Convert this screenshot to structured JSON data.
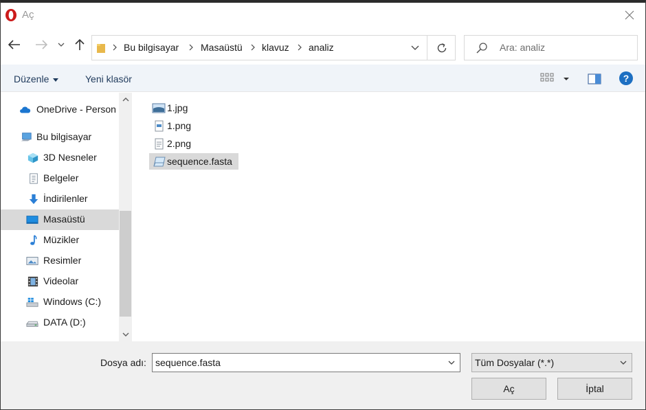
{
  "window": {
    "title": "Aç"
  },
  "navigation": {
    "breadcrumb": [
      "Bu bilgisayar",
      "Masaüstü",
      "klavuz",
      "analiz"
    ],
    "search_placeholder": "Ara: analiz"
  },
  "toolbar": {
    "organize_label": "Düzenle",
    "new_folder_label": "Yeni klasör"
  },
  "sidebar": {
    "items": [
      {
        "label": "OneDrive - Person",
        "icon": "cloud-icon"
      },
      {
        "label": "Bu bilgisayar",
        "icon": "computer-icon"
      },
      {
        "label": "3D Nesneler",
        "icon": "cube-icon"
      },
      {
        "label": "Belgeler",
        "icon": "document-icon"
      },
      {
        "label": "İndirilenler",
        "icon": "download-arrow-icon"
      },
      {
        "label": "Masaüstü",
        "icon": "desktop-icon",
        "selected": true
      },
      {
        "label": "Müzikler",
        "icon": "music-note-icon"
      },
      {
        "label": "Resimler",
        "icon": "picture-icon"
      },
      {
        "label": "Videolar",
        "icon": "film-icon"
      },
      {
        "label": "Windows (C:)",
        "icon": "windows-drive-icon"
      },
      {
        "label": "DATA (D:)",
        "icon": "drive-icon"
      }
    ]
  },
  "files": [
    {
      "name": "1.jpg",
      "icon": "image-file-icon"
    },
    {
      "name": "1.png",
      "icon": "png-file-icon"
    },
    {
      "name": "2.png",
      "icon": "png-file-icon"
    },
    {
      "name": "sequence.fasta",
      "icon": "generic-file-icon",
      "selected": true
    }
  ],
  "footer": {
    "filename_label": "Dosya adı:",
    "filename_value": "sequence.fasta",
    "filetype_value": "Tüm Dosyalar (*.*)",
    "open_label": "Aç",
    "cancel_label": "İptal"
  },
  "colors": {
    "accent": "#0078d7",
    "selection": "#d9d9d9",
    "toolbar_bg": "#f0f4f9",
    "footer_bg": "#f0f0f0",
    "opera_red": "#cc1b1b"
  }
}
